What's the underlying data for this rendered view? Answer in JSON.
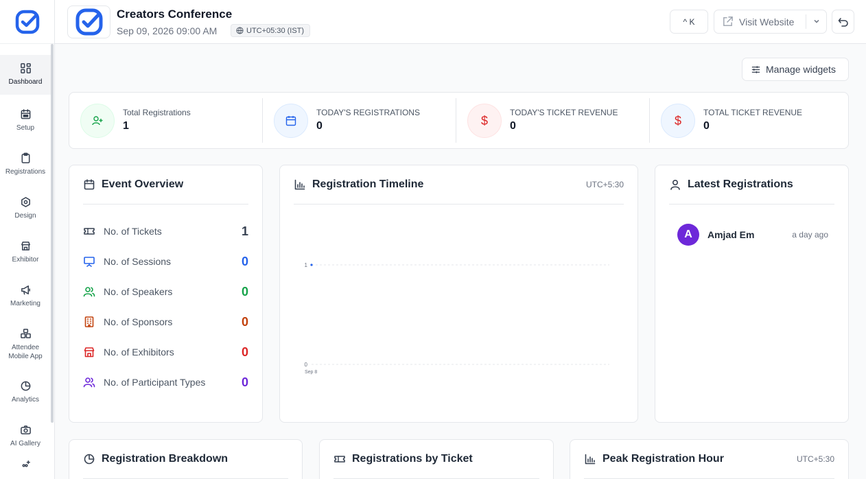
{
  "sidebar": {
    "items": [
      {
        "label": "Dashboard",
        "icon": "dashboard-icon"
      },
      {
        "label": "Setup",
        "icon": "calendar-icon"
      },
      {
        "label": "Registrations",
        "icon": "clipboard-icon"
      },
      {
        "label": "Design",
        "icon": "design-icon"
      },
      {
        "label": "Exhibitor",
        "icon": "store-icon"
      },
      {
        "label": "Marketing",
        "icon": "megaphone-icon"
      },
      {
        "label": "Attendee Mobile App",
        "icon": "app-icon"
      },
      {
        "label": "Analytics",
        "icon": "pie-chart-icon"
      },
      {
        "label": "AI Gallery",
        "icon": "camera-icon"
      }
    ]
  },
  "header": {
    "title": "Creators Conference",
    "date": "Sep 09, 2026 09:00 AM",
    "timezone": "UTC+05:30 (IST)",
    "shortcut": "^ K",
    "visit_label": "Visit Website"
  },
  "toolbar": {
    "manage_widgets": "Manage widgets"
  },
  "stats": [
    {
      "label": "Total Registrations",
      "value": "1",
      "color": "#16a34a",
      "bg": "#f0fdf4"
    },
    {
      "label": "TODAY'S REGISTRATIONS",
      "value": "0",
      "color": "#2563eb",
      "bg": "#eff6ff"
    },
    {
      "label": "TODAY'S TICKET REVENUE",
      "value": "0",
      "color": "#dc2626",
      "bg": "#fef2f2"
    },
    {
      "label": "TOTAL TICKET REVENUE",
      "value": "0",
      "color": "#dc2626",
      "bg": "#eff6ff"
    }
  ],
  "event_overview": {
    "title": "Event Overview",
    "rows": [
      {
        "label": "No. of Tickets",
        "value": "1",
        "color": "#374151"
      },
      {
        "label": "No. of Sessions",
        "value": "0",
        "color": "#2563eb"
      },
      {
        "label": "No. of Speakers",
        "value": "0",
        "color": "#16a34a"
      },
      {
        "label": "No. of Sponsors",
        "value": "0",
        "color": "#c2410c"
      },
      {
        "label": "No. of Exhibitors",
        "value": "0",
        "color": "#dc2626"
      },
      {
        "label": "No. of Participant Types",
        "value": "0",
        "color": "#6d28d9"
      }
    ]
  },
  "timeline": {
    "title": "Registration Timeline",
    "tz": "UTC+5:30"
  },
  "chart_data": {
    "type": "line",
    "title": "Registration Timeline",
    "x": [
      "Sep 8"
    ],
    "series": [
      {
        "values": [
          1
        ]
      }
    ],
    "yticks": [
      "0",
      "1"
    ],
    "ylim": [
      0,
      1
    ]
  },
  "latest": {
    "title": "Latest Registrations",
    "items": [
      {
        "initial": "A",
        "name": "Amjad Em",
        "time": "a day ago"
      }
    ]
  },
  "bottom": {
    "breakdown": "Registration Breakdown",
    "by_ticket": "Registrations by Ticket",
    "peak": "Peak Registration Hour",
    "peak_tz": "UTC+5:30"
  }
}
